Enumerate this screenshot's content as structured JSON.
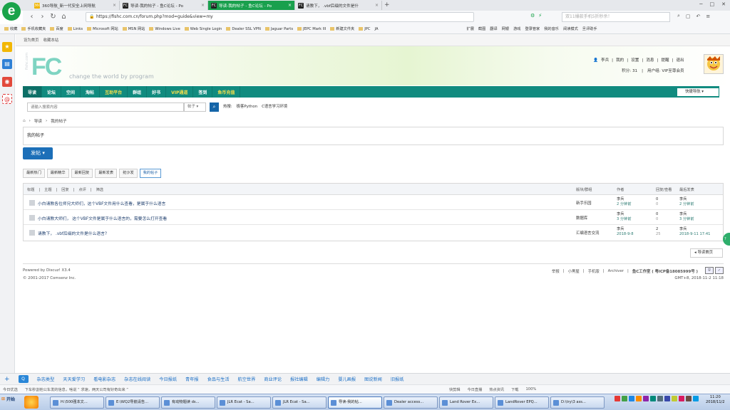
{
  "browser": {
    "tabs": [
      {
        "label": "360导航_新一代安全上网导航",
        "fav": "360",
        "active": false
      },
      {
        "label": "导读-我的帖子 - 鱼C论坛 - Po",
        "fav": "FC",
        "active": false
      },
      {
        "label": "导读-我的帖子 - 鱼C论坛 - Po",
        "fav": "FC",
        "active": true
      },
      {
        "label": "请教下， .vbf后缀的文件是什",
        "fav": "FC",
        "active": false
      }
    ],
    "new_tab": "+",
    "url": "https://fishc.com.cn/forum.php?mod=guide&view=my",
    "url_host": "fishc.com.cn",
    "search_placeholder": "双11爆款手机5折秒杀！",
    "bookmarks": [
      "收藏",
      "手机收藏夹",
      "百度",
      "Links",
      "Microsoft 网站",
      "MSN 网站",
      "Windows Live",
      "Web Single Login",
      "Dealer SSL VPN",
      "Jaguar Parts",
      "JEPC Mark III",
      "新建文件夹",
      "JPC",
      "JA",
      "扩展",
      "截图",
      "翻译",
      "网银",
      "游戏",
      "登录管家",
      "我的音乐",
      "阅读模式",
      "旦评助手"
    ]
  },
  "site": {
    "topbar": [
      "设为首页",
      "收藏本站"
    ],
    "logo_text": "FC",
    "logo_url": "fishc.com",
    "tagline": "change the world by program",
    "user": {
      "name": "李兵",
      "links": [
        "我的",
        "设置",
        "消息",
        "提醒",
        "退出"
      ],
      "credits": "积分: 31",
      "group": "用户组: VIP至尊会员"
    },
    "nav": [
      "导读",
      "论坛",
      "空间",
      "淘帖",
      "互助平台",
      "群组",
      "好书",
      "VIP通道",
      "签到",
      "鱼币充值"
    ],
    "nav_hot": [
      "互助平台",
      "VIP通道",
      "鱼币充值"
    ],
    "quick_nav": "快捷导航",
    "search": {
      "placeholder": "请输入搜索内容",
      "type": "帖子",
      "hot_label": "热搜:",
      "hot_words": [
        "极客Python",
        "C语言学习环境"
      ]
    },
    "breadcrumb": [
      "导读",
      "我的帖子"
    ],
    "box_title": "我的帖子",
    "post_button": "发帖",
    "subtabs": [
      "最新热门",
      "最新精华",
      "最新回复",
      "最新发表",
      "抢沙发",
      "我的帖子"
    ],
    "list_header": {
      "filters": [
        "标题",
        "主题",
        "回复",
        "点评",
        "筛选"
      ],
      "forum": "版块/群组",
      "author": "作者",
      "counts": "回复/查看",
      "last": "最后发表"
    },
    "threads": [
      {
        "subject": "小白请教各位师兄大师们，这个VBF文件用什么查看，是属于什么语言",
        "forum": "新手乐园",
        "author": "李兵",
        "date": "2 分钟前",
        "replies": "0",
        "views": "0",
        "last_author": "李兵",
        "last_date": "2 分钟前"
      },
      {
        "subject": "小白请教大师们， 这个VBF文件是属于什么语言的，需要怎么打开查看",
        "forum": "数据库",
        "author": "李兵",
        "date": "3 分钟前",
        "replies": "0",
        "views": "0",
        "last_author": "李兵",
        "last_date": "3 分钟前"
      },
      {
        "subject": "请教下， .vbf后缀的文件是什么语言？",
        "forum": "汇编语言交流",
        "author": "李兵",
        "date": "2018-9-8",
        "replies": "2",
        "views": "25",
        "last_author": "李兵",
        "last_date": "2018-9-11 17:41"
      }
    ],
    "back_button": "导读首页",
    "footer": {
      "powered": "Powered by Discuz! X3.4",
      "copyright": "© 2001-2017 Comsenz Inc.",
      "links": [
        "举报",
        "小黑屋",
        "手机版",
        "Archiver",
        "鱼C工作室 ( 粤ICP备18085999号 )"
      ],
      "time": "GMT+8, 2018-11-2 11:18"
    }
  },
  "sitebar": [
    "杂志类型",
    "天天爱学习",
    "看电影杂志",
    "杂志在线阅读",
    "今日报纸",
    "青年报",
    "食品与生活",
    "航空世界",
    "商业评论",
    "报社编辑",
    "编辑力",
    "婴儿画报",
    "图说新闻",
    "旧报纸"
  ],
  "statusbar": {
    "left": "今日优选",
    "news": "下车秒割他公车发的信息，啥说 “ 求速，两天公司有好奇出来 ”",
    "items": [
      "快剪辑",
      "今日直播",
      "热点资讯",
      "下载"
    ],
    "zoom": "100%"
  },
  "taskbar": {
    "start": "开始",
    "items": [
      "H:\\500强本文...",
      "E:\\WQ2导航请告...",
      "有动物题读 ds...",
      "JLR Ecat - Sa...",
      "JLR Ecat - Sa...",
      "导读-我的帖...",
      "Dealer access...",
      "Land Rover Ex...",
      "LandRover EPQ...",
      "D:\\try\\3 ass..."
    ],
    "time": "11:20",
    "date": "2018/11/2"
  },
  "colors": {
    "nav_bg": "#118b7f",
    "active_tab": "#19a04d",
    "post_button": "#1c6fb8",
    "link": "#1f3f6e"
  }
}
